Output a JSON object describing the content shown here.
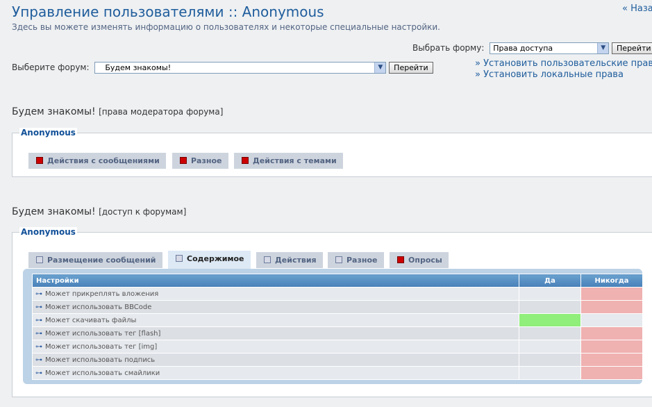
{
  "header": {
    "title": "Управление пользователями :: Anonymous",
    "description": "Здесь вы можете изменять информацию о пользователях и некоторые специальные настройки.",
    "back_link": "« Наза"
  },
  "form_select": {
    "label": "Выбрать форму:",
    "value": "Права доступа",
    "button": "Перейти"
  },
  "forum_select": {
    "label": "Выберите форум:",
    "value": "Будем знакомы!",
    "button": "Перейти"
  },
  "links": [
    "» Установить пользовательские прав",
    "» Установить локальные права"
  ],
  "section1": {
    "title": "Будем знакомы!",
    "subtitle": "[права модератора форума]",
    "user": "Anonymous",
    "tabs": [
      {
        "label": "Действия с сообщениями",
        "state": "red"
      },
      {
        "label": "Разное",
        "state": "red"
      },
      {
        "label": "Действия с темами",
        "state": "red"
      }
    ]
  },
  "section2": {
    "title": "Будем знакомы!",
    "subtitle": "[доступ к форумам]",
    "user": "Anonymous",
    "tabs": [
      {
        "label": "Размещение сообщений",
        "state": "empty"
      },
      {
        "label": "Содержимое",
        "state": "empty",
        "active": true
      },
      {
        "label": "Действия",
        "state": "empty"
      },
      {
        "label": "Разное",
        "state": "empty"
      },
      {
        "label": "Опросы",
        "state": "red"
      }
    ],
    "table": {
      "headers": [
        "Настройки",
        "Да",
        "Никогда"
      ],
      "rows": [
        {
          "label": "Может прикреплять вложения",
          "value": "never"
        },
        {
          "label": "Может использовать BBCode",
          "value": "never"
        },
        {
          "label": "Может скачивать файлы",
          "value": "yes"
        },
        {
          "label": "Может использовать тег [flash]",
          "value": "never"
        },
        {
          "label": "Может использовать тег [img]",
          "value": "never"
        },
        {
          "label": "Может использовать подпись",
          "value": "never"
        },
        {
          "label": "Может использовать смайлики",
          "value": "never"
        }
      ]
    }
  },
  "colors": {
    "yes": "#90ee7a",
    "never": "#f0b1b1",
    "accent": "#1f5d9c"
  }
}
